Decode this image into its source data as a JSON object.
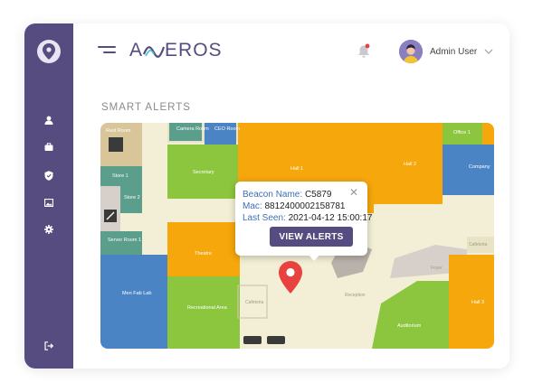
{
  "brand": {
    "name": "AWEROS",
    "prefix": "A",
    "suffix": "EROS"
  },
  "colors": {
    "accent": "#574c7f",
    "notification_dot": "#e8413e",
    "pin": "#e8413e",
    "link_blue": "#3d6fb6"
  },
  "sidebar": {
    "logo_icon": "location-pin-icon",
    "items": [
      {
        "icon": "user-icon"
      },
      {
        "icon": "briefcase-icon"
      },
      {
        "icon": "shield-icon"
      },
      {
        "icon": "image-icon"
      },
      {
        "icon": "gear-icon"
      }
    ],
    "bottom_icon": "logout-icon"
  },
  "header": {
    "menu_icon": "hamburger-icon",
    "bell_icon": "bell-icon",
    "user_name": "Admin User",
    "dropdown_icon": "chevron-down-icon"
  },
  "page": {
    "title": "SMART ALERTS"
  },
  "map": {
    "rooms": {
      "rest_room": "Rest Room",
      "camera_room": "Camera Room",
      "ceo_room": "CEO Room",
      "hall1": "Hall 1",
      "hall2": "Hall 2",
      "office1": "Office 1",
      "company": "Company",
      "store1": "Store 1",
      "store2": "Store 2",
      "secretary": "Secretary",
      "server_room": "Server Room 1",
      "men_fab_lab": "Men Fab Lab",
      "theatre": "Theatre",
      "recreational": "Recreational Area",
      "cafeteria": "Cafeteria",
      "cafeteria2": "Cafeteria",
      "reception": "Reception",
      "foyer": "Foyer",
      "auditorium": "Auditorium",
      "hall3": "Hall 3"
    },
    "popup": {
      "beacon_label": "Beacon Name:",
      "beacon_value": "C5879",
      "mac_label": "Mac:",
      "mac_value": "8812400002158781",
      "last_seen_label": "Last Seen:",
      "last_seen_value": "2021-04-12 15:00:17",
      "close": "✕",
      "button": "VIEW ALERTS"
    },
    "marker_icon": "map-pin-icon"
  }
}
